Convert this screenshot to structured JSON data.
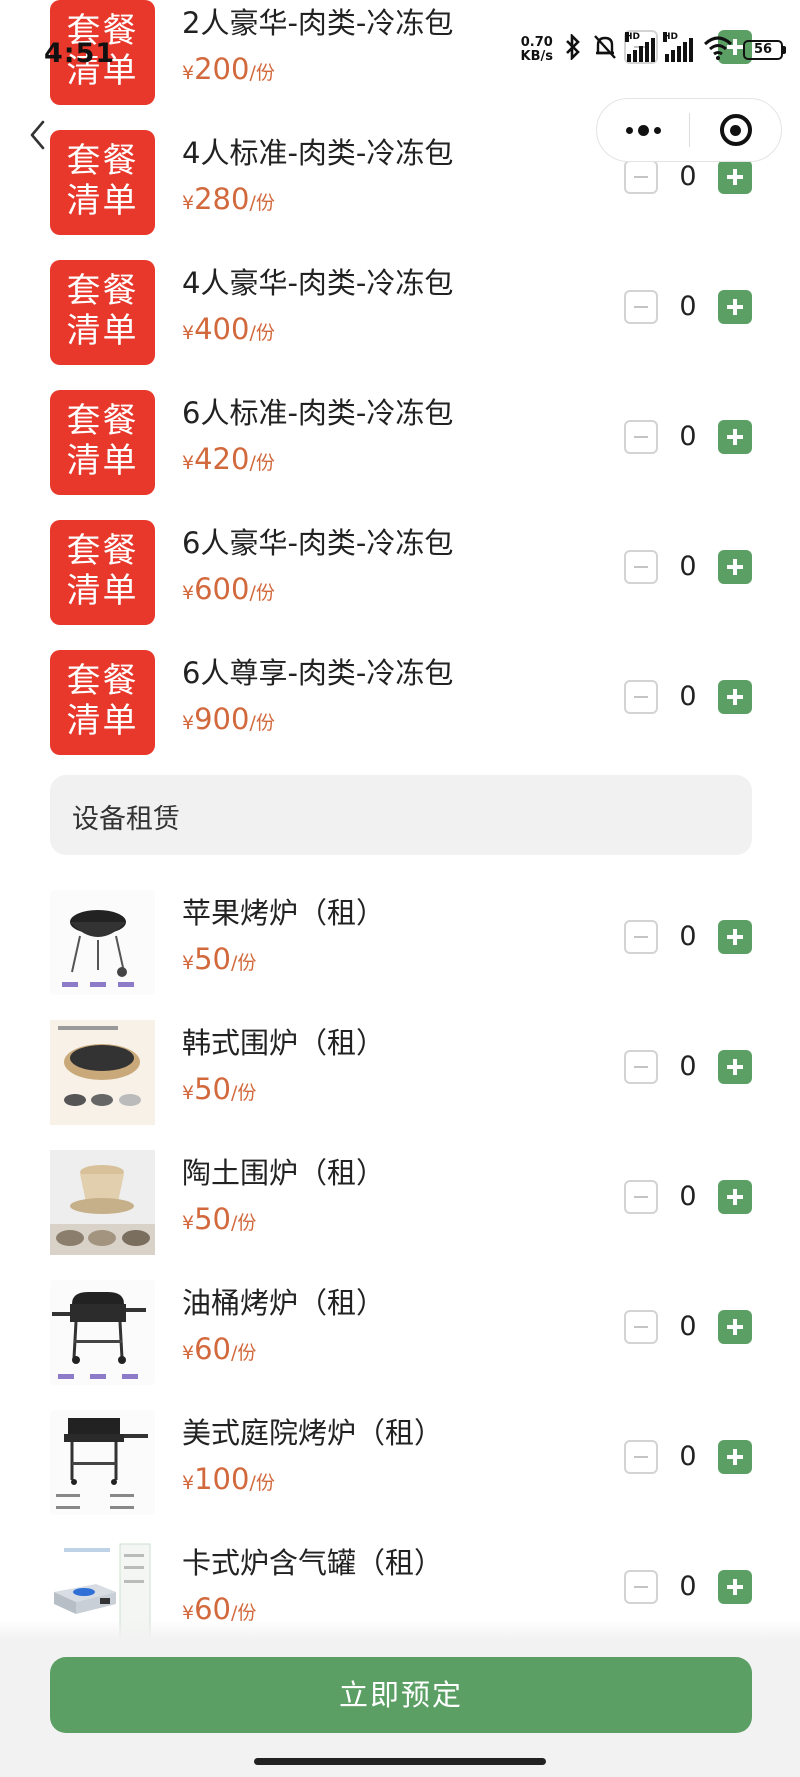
{
  "status_bar": {
    "time": "4:51",
    "net_speed_value": "0.70",
    "net_speed_unit": "KB/s",
    "hd_label": "HD",
    "battery": "56",
    "icons": [
      "bluetooth-icon",
      "mute-bell-icon",
      "signal-icon",
      "signal-icon",
      "wifi-icon",
      "battery-icon"
    ]
  },
  "nav": {
    "icons": [
      "back-chevron-icon",
      "more-dots-icon",
      "target-icon"
    ]
  },
  "colors": {
    "badge_red": "#e8372b",
    "accent_green": "#5b9f65",
    "price_orange": "#d2693d",
    "section_bg": "#f1f1f1"
  },
  "badge": {
    "line1": "套餐",
    "line2": "清单"
  },
  "price": {
    "currency": "¥",
    "unit": "/份"
  },
  "packages": [
    {
      "name": "2人豪华-肉类-冷冻包",
      "price": "200"
    },
    {
      "name": "4人标准-肉类-冷冻包",
      "price": "280",
      "qty": "0"
    },
    {
      "name": "4人豪华-肉类-冷冻包",
      "price": "400",
      "qty": "0"
    },
    {
      "name": "6人标准-肉类-冷冻包",
      "price": "420",
      "qty": "0"
    },
    {
      "name": "6人豪华-肉类-冷冻包",
      "price": "600",
      "qty": "0"
    },
    {
      "name": "6人尊享-肉类-冷冻包",
      "price": "900",
      "qty": "0"
    }
  ],
  "section_title": "设备租赁",
  "rentals": [
    {
      "name": "苹果烤炉（租）",
      "price": "50",
      "qty": "0",
      "image": "kettle-grill-image"
    },
    {
      "name": "韩式围炉（租）",
      "price": "50",
      "qty": "0",
      "image": "korean-grill-image"
    },
    {
      "name": "陶土围炉（租）",
      "price": "50",
      "qty": "0",
      "image": "clay-stove-image"
    },
    {
      "name": "油桶烤炉（租）",
      "price": "60",
      "qty": "0",
      "image": "barrel-grill-image"
    },
    {
      "name": "美式庭院烤炉（租）",
      "price": "100",
      "qty": "0",
      "image": "american-grill-image"
    },
    {
      "name": "卡式炉含气罐（租）",
      "price": "60",
      "qty": "0",
      "image": "cassette-stove-image"
    }
  ],
  "book_button": "立即预定"
}
